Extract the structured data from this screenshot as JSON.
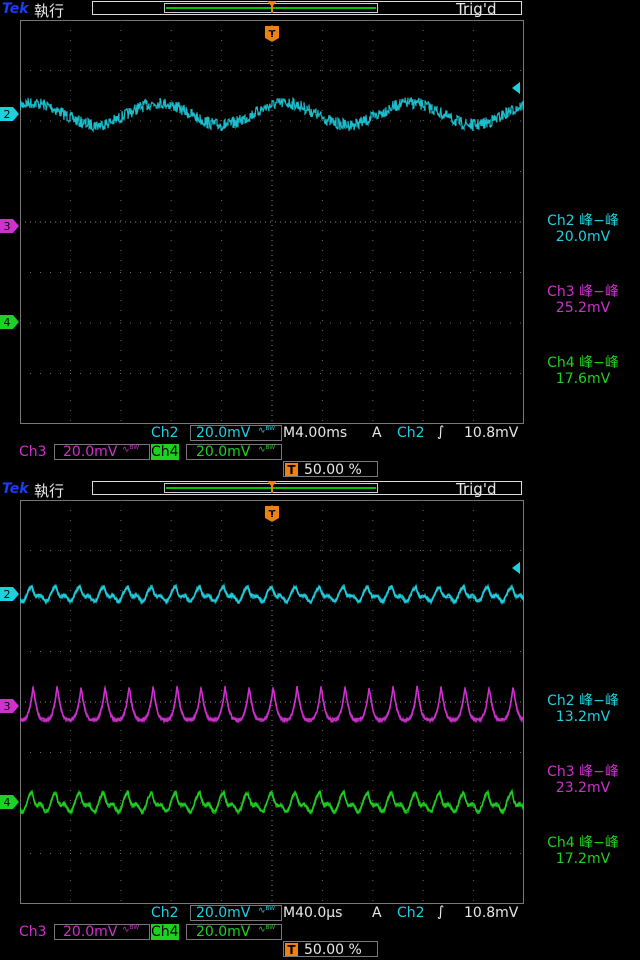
{
  "panels": [
    {
      "brand": "Tek",
      "run_state": "執行",
      "trig_status": "Trig'd",
      "channel_markers": [
        "2",
        "3",
        "4"
      ],
      "measurements": [
        {
          "label": "Ch2 峰−峰",
          "value": "20.0mV",
          "color": "#1fd0e0"
        },
        {
          "label": "Ch3 峰−峰",
          "value": "25.2mV",
          "color": "#d030d0"
        },
        {
          "label": "Ch4 峰−峰",
          "value": "17.6mV",
          "color": "#20d020"
        }
      ],
      "status": {
        "ch2": "Ch2",
        "ch2_scale": "20.0mV",
        "time_scale": "M4.00ms",
        "trigger_mode": "A",
        "trigger_source": "Ch2",
        "trigger_level": "10.8mV",
        "ch3": "Ch3",
        "ch3_scale": "20.0mV",
        "ch4": "Ch4",
        "ch4_scale": "20.0mV",
        "trigger_position": "50.00 %"
      },
      "waveforms": {
        "ch2": {
          "shape": "sine",
          "cycles": 4
        },
        "ch3": {
          "shape": "noise"
        },
        "ch4": {
          "shape": "noise"
        }
      }
    },
    {
      "brand": "Tek",
      "run_state": "執行",
      "trig_status": "Trig'd",
      "channel_markers": [
        "2",
        "3",
        "4"
      ],
      "measurements": [
        {
          "label": "Ch2 峰−峰",
          "value": "13.2mV",
          "color": "#1fd0e0"
        },
        {
          "label": "Ch3 峰−峰",
          "value": "23.2mV",
          "color": "#d030d0"
        },
        {
          "label": "Ch4 峰−峰",
          "value": "17.2mV",
          "color": "#20d020"
        }
      ],
      "status": {
        "ch2": "Ch2",
        "ch2_scale": "20.0mV",
        "time_scale": "M40.0µs",
        "trigger_mode": "A",
        "trigger_source": "Ch2",
        "trigger_level": "10.8mV",
        "ch3": "Ch3",
        "ch3_scale": "20.0mV",
        "ch4": "Ch4",
        "ch4_scale": "20.0mV",
        "trigger_position": "50.00 %"
      },
      "waveforms": {
        "ch2": {
          "shape": "ripple",
          "cycles": 21
        },
        "ch3": {
          "shape": "spikes",
          "cycles": 21
        },
        "ch4": {
          "shape": "ripple",
          "cycles": 21
        }
      }
    }
  ],
  "colors": {
    "ch2": "#1fd0e0",
    "ch3": "#d030d0",
    "ch4": "#20d020",
    "trigger": "#f08010",
    "grid": "#888888"
  }
}
